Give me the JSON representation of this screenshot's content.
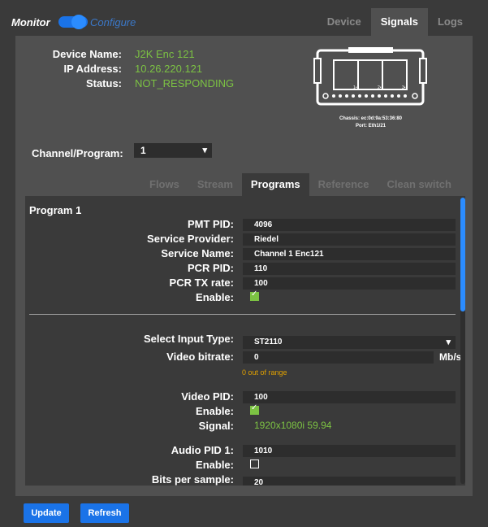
{
  "mode": {
    "monitor_label": "Monitor",
    "configure_label": "Configure"
  },
  "main_tabs": [
    {
      "label": "Device"
    },
    {
      "label": "Signals"
    },
    {
      "label": "Logs"
    }
  ],
  "device_info": {
    "device_name_label": "Device Name:",
    "device_name": "J2K Enc 121",
    "ip_label": "IP Address:",
    "ip": "10.26.220.121",
    "status_label": "Status:",
    "status": "NOT_RESPONDING"
  },
  "chassis": {
    "chassis_text": "Chassis: ec:0d:9a:53:36:80",
    "port_text": "Port: Eth1/21",
    "port_labels": [
      "1•",
      "2•",
      "3•"
    ]
  },
  "channel": {
    "label": "Channel/Program:",
    "value": "1"
  },
  "sub_tabs": [
    {
      "label": "Flows"
    },
    {
      "label": "Stream"
    },
    {
      "label": "Programs"
    },
    {
      "label": "Reference"
    },
    {
      "label": "Clean switch"
    }
  ],
  "program": {
    "title": "Program 1",
    "pmt_pid_label": "PMT PID:",
    "pmt_pid": "4096",
    "service_provider_label": "Service Provider:",
    "service_provider": "Riedel",
    "service_name_label": "Service Name:",
    "service_name": "Channel 1 Enc121",
    "pcr_pid_label": "PCR PID:",
    "pcr_pid": "110",
    "pcr_tx_rate_label": "PCR TX rate:",
    "pcr_tx_rate": "100",
    "enable_label": "Enable:",
    "enable": true
  },
  "input": {
    "select_type_label": "Select Input Type:",
    "select_type": "ST2110",
    "video_bitrate_label": "Video bitrate:",
    "video_bitrate": "0",
    "video_bitrate_unit": "Mb/s",
    "video_bitrate_warning": "0 out of range",
    "video_pid_label": "Video PID:",
    "video_pid": "100",
    "video_enable_label": "Enable:",
    "video_enable": true,
    "signal_label": "Signal:",
    "signal": "1920x1080i 59.94",
    "audio_pid_label": "Audio PID 1:",
    "audio_pid": "1010",
    "audio_enable_label": "Enable:",
    "audio_enable": false,
    "bits_per_sample_label": "Bits per sample:",
    "bits_per_sample": "20"
  },
  "buttons": {
    "update": "Update",
    "refresh": "Refresh"
  },
  "colors": {
    "accent": "#1a73e8",
    "ok_text": "#7cc243",
    "warning": "#e0a000",
    "panel": "#505050",
    "background": "#3a3a3a"
  }
}
